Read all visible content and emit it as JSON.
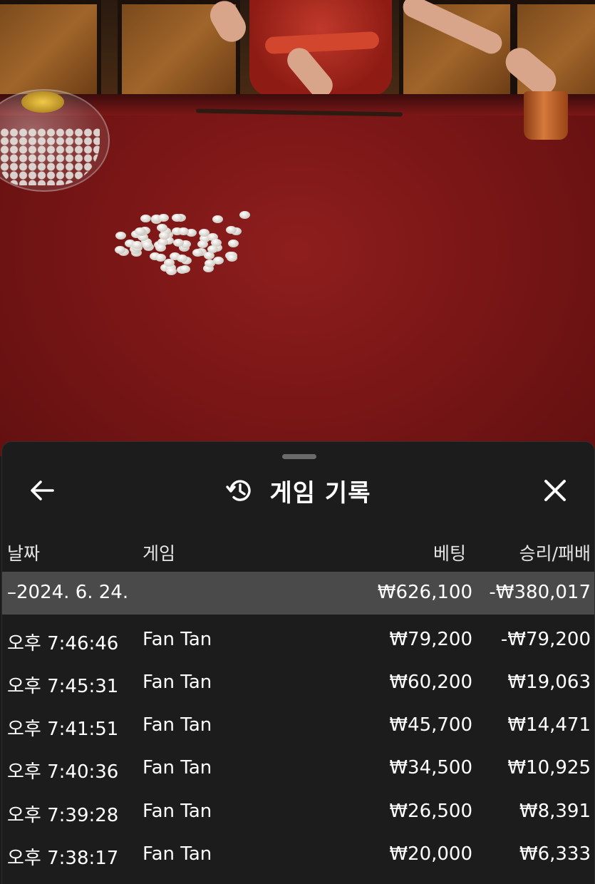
{
  "history": {
    "title": "게임 기록",
    "columns": {
      "date": "날짜",
      "game": "게임",
      "bet": "베팅",
      "result": "승리/패배"
    },
    "summary": {
      "label": "–2024. 6. 24.",
      "bet": "₩626,100",
      "result": "-₩380,017"
    },
    "rows": [
      {
        "time": "오후 7:46:46",
        "game": "Fan Tan",
        "bet": "₩79,200",
        "result": "-₩79,200"
      },
      {
        "time": "오후 7:45:31",
        "game": "Fan Tan",
        "bet": "₩60,200",
        "result": "₩19,063"
      },
      {
        "time": "오후 7:41:51",
        "game": "Fan Tan",
        "bet": "₩45,700",
        "result": "₩14,471"
      },
      {
        "time": "오후 7:40:36",
        "game": "Fan Tan",
        "bet": "₩34,500",
        "result": "₩10,925"
      },
      {
        "time": "오후 7:39:28",
        "game": "Fan Tan",
        "bet": "₩26,500",
        "result": "₩8,391"
      },
      {
        "time": "오후 7:38:17",
        "game": "Fan Tan",
        "bet": "₩20,000",
        "result": "₩6,333"
      }
    ]
  },
  "icons": {
    "back": "arrow-left-icon",
    "history": "history-clock-icon",
    "close": "close-icon"
  },
  "colors": {
    "sheet_background": "#1c1c1c",
    "summary_row": "#4a4a4a",
    "text": "#ffffff",
    "felt": "#7a1616"
  }
}
